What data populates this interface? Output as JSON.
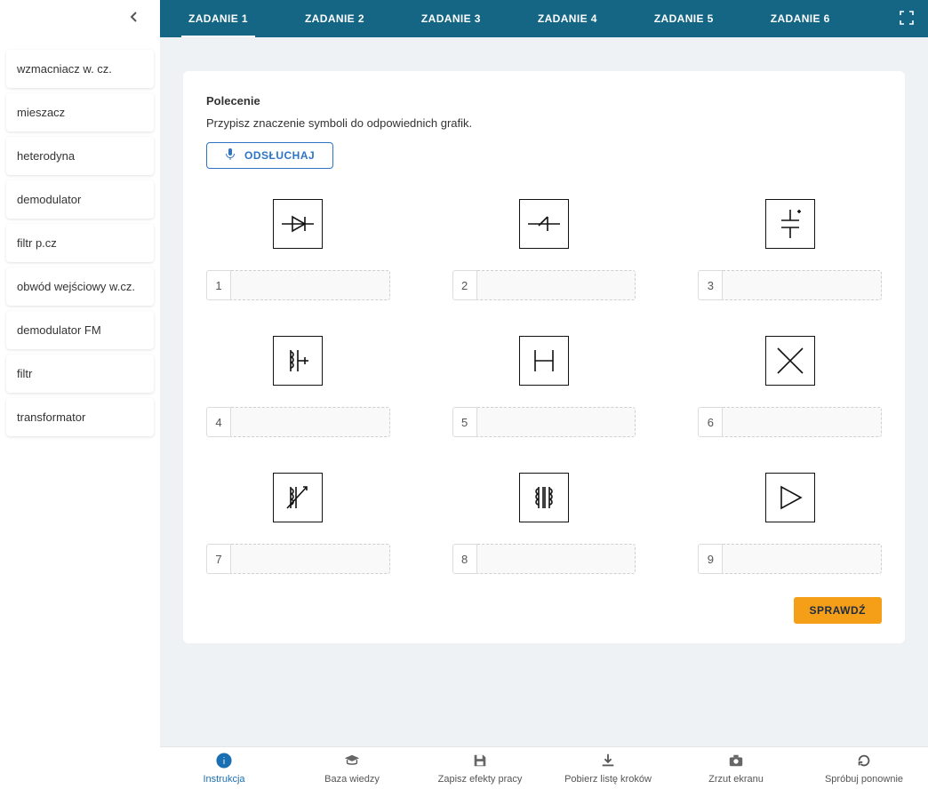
{
  "tabs": {
    "items": [
      {
        "label": "ZADANIE 1",
        "active": true
      },
      {
        "label": "ZADANIE 2",
        "active": false
      },
      {
        "label": "ZADANIE 3",
        "active": false
      },
      {
        "label": "ZADANIE 4",
        "active": false
      },
      {
        "label": "ZADANIE 5",
        "active": false
      },
      {
        "label": "ZADANIE 6",
        "active": false
      }
    ]
  },
  "sidebar": {
    "items": [
      {
        "label": "wzmacniacz w. cz."
      },
      {
        "label": "mieszacz"
      },
      {
        "label": "heterodyna"
      },
      {
        "label": "demodulator"
      },
      {
        "label": "filtr p.cz"
      },
      {
        "label": "obwód wejściowy w.cz."
      },
      {
        "label": "demodulator FM"
      },
      {
        "label": "filtr"
      },
      {
        "label": "transformator"
      }
    ]
  },
  "task": {
    "heading": "Polecenie",
    "instruction": "Przypisz znaczenie symboli do odpowiednich grafik.",
    "listen_label": "ODSŁUCHAJ",
    "check_label": "SPRAWDŹ",
    "cells": [
      {
        "num": "1",
        "icon": "diode"
      },
      {
        "num": "2",
        "icon": "detector"
      },
      {
        "num": "3",
        "icon": "cap-tuned"
      },
      {
        "num": "4",
        "icon": "coil-core"
      },
      {
        "num": "5",
        "icon": "heterodyne"
      },
      {
        "num": "6",
        "icon": "mixer"
      },
      {
        "num": "7",
        "icon": "var-inductor"
      },
      {
        "num": "8",
        "icon": "transformer"
      },
      {
        "num": "9",
        "icon": "amplifier"
      }
    ]
  },
  "bottombar": {
    "items": [
      {
        "label": "Instrukcja",
        "icon": "info",
        "active": true
      },
      {
        "label": "Baza wiedzy",
        "icon": "grad",
        "active": false
      },
      {
        "label": "Zapisz efekty pracy",
        "icon": "save",
        "active": false
      },
      {
        "label": "Pobierz listę kroków",
        "icon": "download",
        "active": false
      },
      {
        "label": "Zrzut ekranu",
        "icon": "camera",
        "active": false
      },
      {
        "label": "Spróbuj ponownie",
        "icon": "refresh",
        "active": false
      }
    ]
  }
}
